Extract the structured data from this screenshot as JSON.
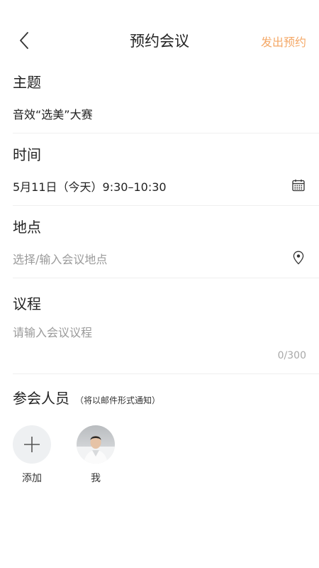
{
  "header": {
    "title": "预约会议",
    "submit_label": "发出预约"
  },
  "topic": {
    "label": "主题",
    "value": "音效“选美”大赛"
  },
  "time": {
    "label": "时间",
    "value": "5月11日（今天）9:30–10:30"
  },
  "location": {
    "label": "地点",
    "placeholder": "选择/输入会议地点"
  },
  "agenda": {
    "label": "议程",
    "placeholder": "请输入会议议程",
    "counter": "0/300"
  },
  "participants": {
    "label": "参会人员",
    "hint": "（将以邮件形式通知）",
    "add_label": "添加",
    "me_label": "我"
  },
  "icons": {
    "back": "chevron-left-icon",
    "calendar": "calendar-icon",
    "location": "location-pin-icon",
    "add": "plus-icon"
  },
  "colors": {
    "accent": "#f4a867",
    "placeholder": "#9a9a9a",
    "divider": "#efefef"
  }
}
